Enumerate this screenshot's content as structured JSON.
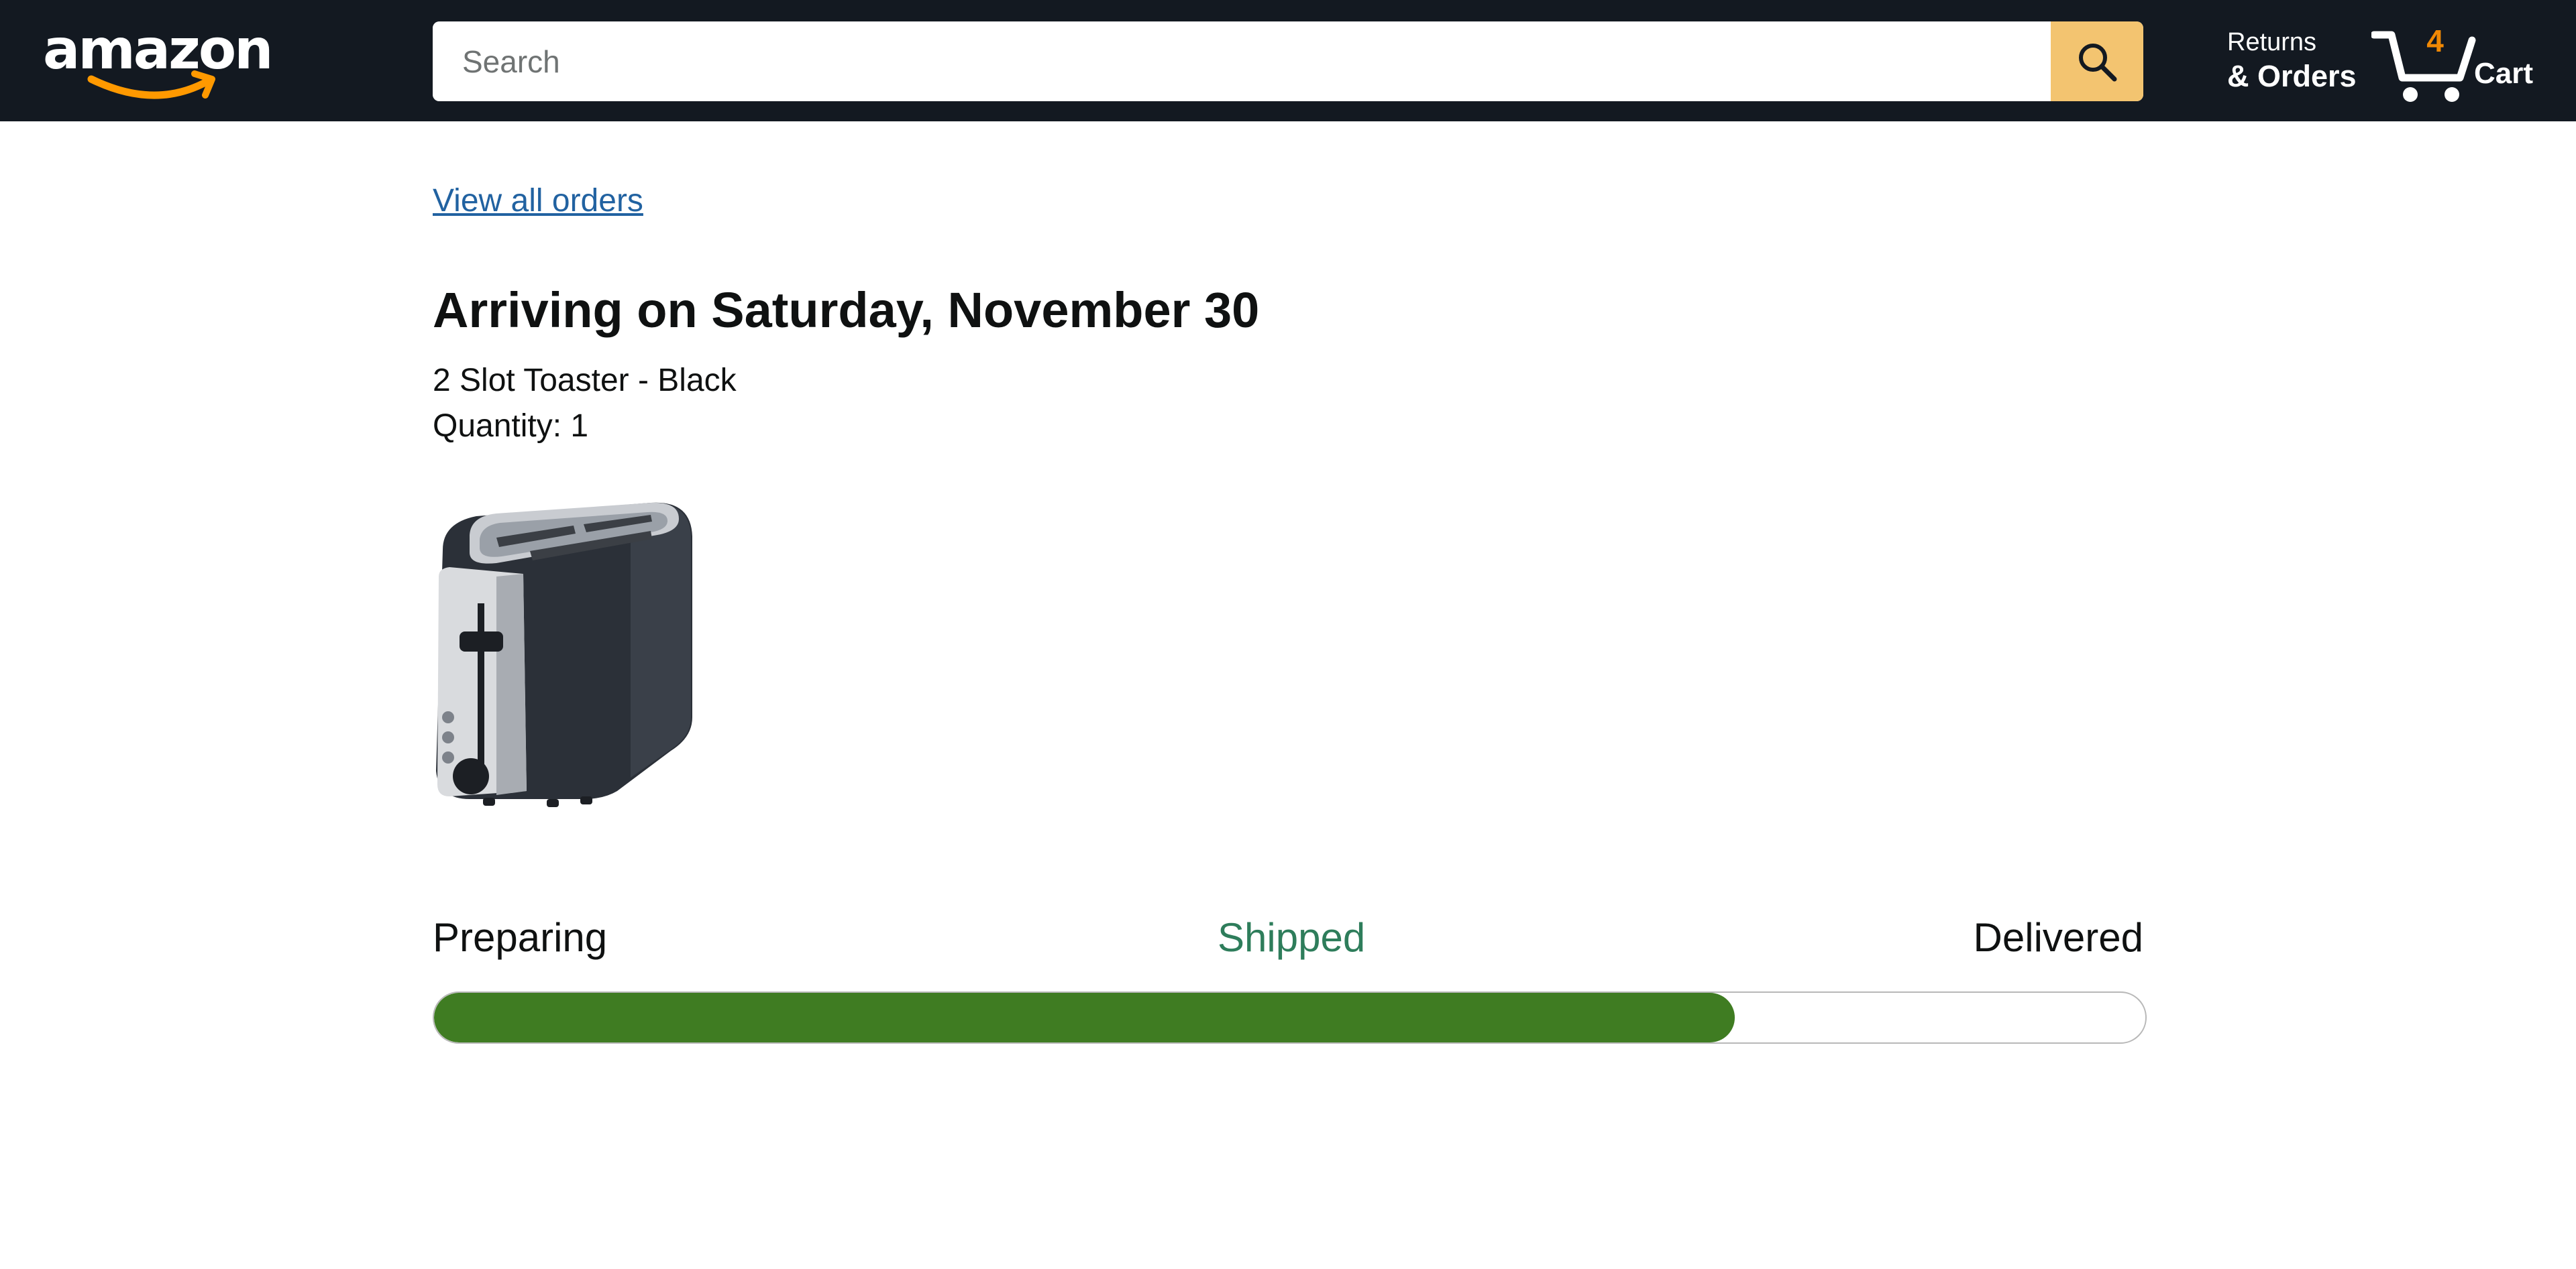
{
  "header": {
    "logo_text": "amazon",
    "search": {
      "placeholder": "Search",
      "value": ""
    },
    "search_button_icon": "search-icon",
    "returns": {
      "line1": "Returns",
      "line2": "& Orders"
    },
    "cart": {
      "count": "4",
      "label": "Cart",
      "icon": "cart-icon"
    }
  },
  "order": {
    "view_all_link": "View all orders",
    "arrival_heading": "Arriving on Saturday, November 30",
    "product_name": "2 Slot Toaster - Black",
    "quantity": "Quantity: 1",
    "product_image": "toaster-image"
  },
  "tracking": {
    "stages": [
      "Preparing",
      "Shipped",
      "Delivered"
    ],
    "current_stage": "Shipped",
    "progress_fraction": 0.76
  },
  "colors": {
    "header_bg": "#131921",
    "search_button": "#f3c470",
    "cart_count": "#f08804",
    "link": "#2162a1",
    "current_stage_text": "#2e7d5b",
    "progress_fill": "#3f7c22"
  }
}
